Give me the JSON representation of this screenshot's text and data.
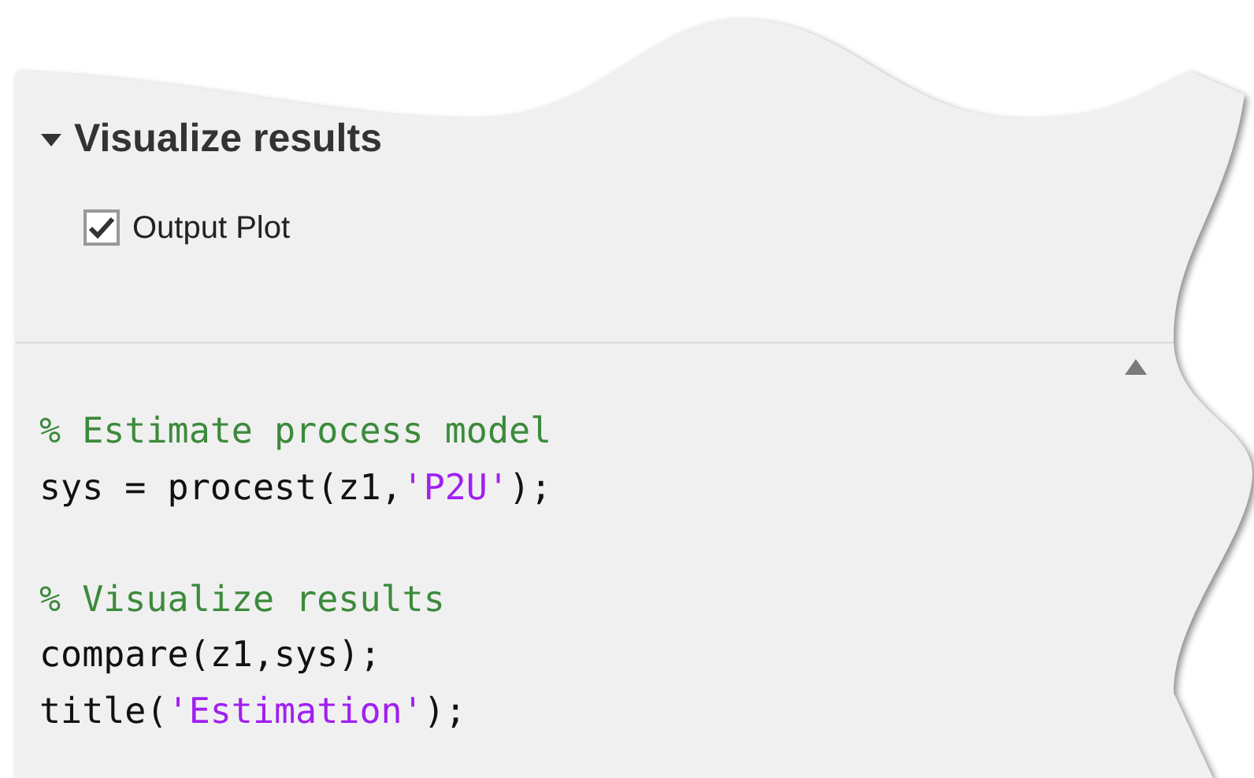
{
  "section": {
    "title": "Visualize results",
    "expanded": true
  },
  "checkbox": {
    "label": "Output Plot",
    "checked": true
  },
  "code": {
    "lines": [
      {
        "kind": "code",
        "tokens": [
          {
            "kind": "comment",
            "text": "% Estimate process model"
          }
        ]
      },
      {
        "kind": "code",
        "tokens": [
          {
            "kind": "plain",
            "text": "sys = procest(z1,"
          },
          {
            "kind": "string",
            "text": "'P2U'"
          },
          {
            "kind": "plain",
            "text": ");"
          }
        ]
      },
      {
        "kind": "blank"
      },
      {
        "kind": "code",
        "tokens": [
          {
            "kind": "comment",
            "text": "% Visualize results"
          }
        ]
      },
      {
        "kind": "code",
        "tokens": [
          {
            "kind": "plain",
            "text": "compare(z1,sys);"
          }
        ]
      },
      {
        "kind": "code",
        "tokens": [
          {
            "kind": "plain",
            "text": "title("
          },
          {
            "kind": "string",
            "text": "'Estimation'"
          },
          {
            "kind": "plain",
            "text": ");"
          }
        ]
      }
    ]
  }
}
